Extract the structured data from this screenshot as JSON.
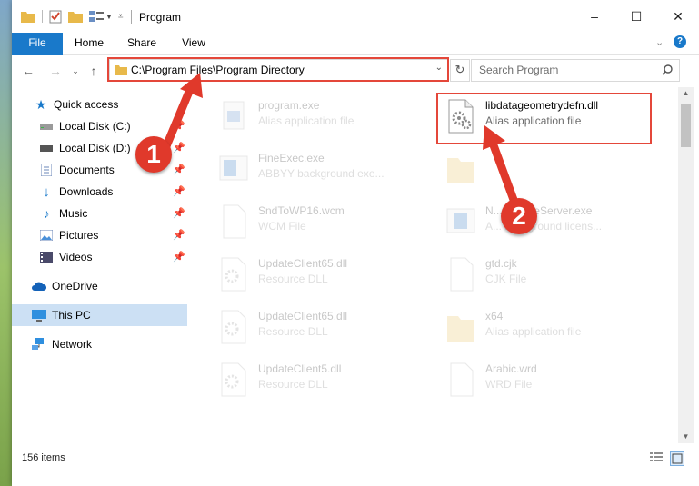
{
  "window": {
    "title": "Program",
    "controls": [
      "–",
      "☐",
      "✕"
    ]
  },
  "ribbon": {
    "tabs": [
      "File",
      "Home",
      "Share",
      "View"
    ]
  },
  "address_bar": {
    "path": "C:\\Program Files\\Program Directory"
  },
  "search": {
    "placeholder": "Search Program"
  },
  "nav": {
    "items": [
      {
        "label": "Quick access",
        "icon": "star-icon"
      },
      {
        "label": "Local Disk (C:)",
        "icon": "drive-icon"
      },
      {
        "label": "Local Disk (D:)",
        "icon": "drive-icon"
      },
      {
        "label": "Documents",
        "icon": "documents-icon"
      },
      {
        "label": "Downloads",
        "icon": "download-icon"
      },
      {
        "label": "Music",
        "icon": "music-icon"
      },
      {
        "label": "Pictures",
        "icon": "pictures-icon"
      },
      {
        "label": "Videos",
        "icon": "videos-icon"
      },
      {
        "label": "OneDrive",
        "icon": "cloud-icon"
      },
      {
        "label": "This PC",
        "icon": "computer-icon"
      },
      {
        "label": "Network",
        "icon": "network-icon"
      }
    ]
  },
  "files": [
    {
      "name": "program.exe",
      "type": "Alias application file"
    },
    {
      "name": "libdatageometrydefn.dll",
      "type": "Alias application file"
    },
    {
      "name": "FineExec.exe",
      "type": "ABBYY background exe..."
    },
    {
      "name": "",
      "type": ""
    },
    {
      "name": "SndToWP16.wcm",
      "type": "WCM File"
    },
    {
      "name": "N...LicenseServer.exe",
      "type": "A... background licens..."
    },
    {
      "name": "UpdateClient65.dll",
      "type": "Resource DLL"
    },
    {
      "name": "gtd.cjk",
      "type": "CJK File"
    },
    {
      "name": "UpdateClient65.dll",
      "type": "Resource DLL"
    },
    {
      "name": "x64",
      "type": "Alias application file"
    },
    {
      "name": "UpdateClient5.dll",
      "type": "Resource DLL"
    },
    {
      "name": "Arabic.wrd",
      "type": "WRD File"
    }
  ],
  "status": {
    "item_count": "156 items"
  },
  "annotations": {
    "step1": "1",
    "step2": "2",
    "color": "#e0392b"
  }
}
